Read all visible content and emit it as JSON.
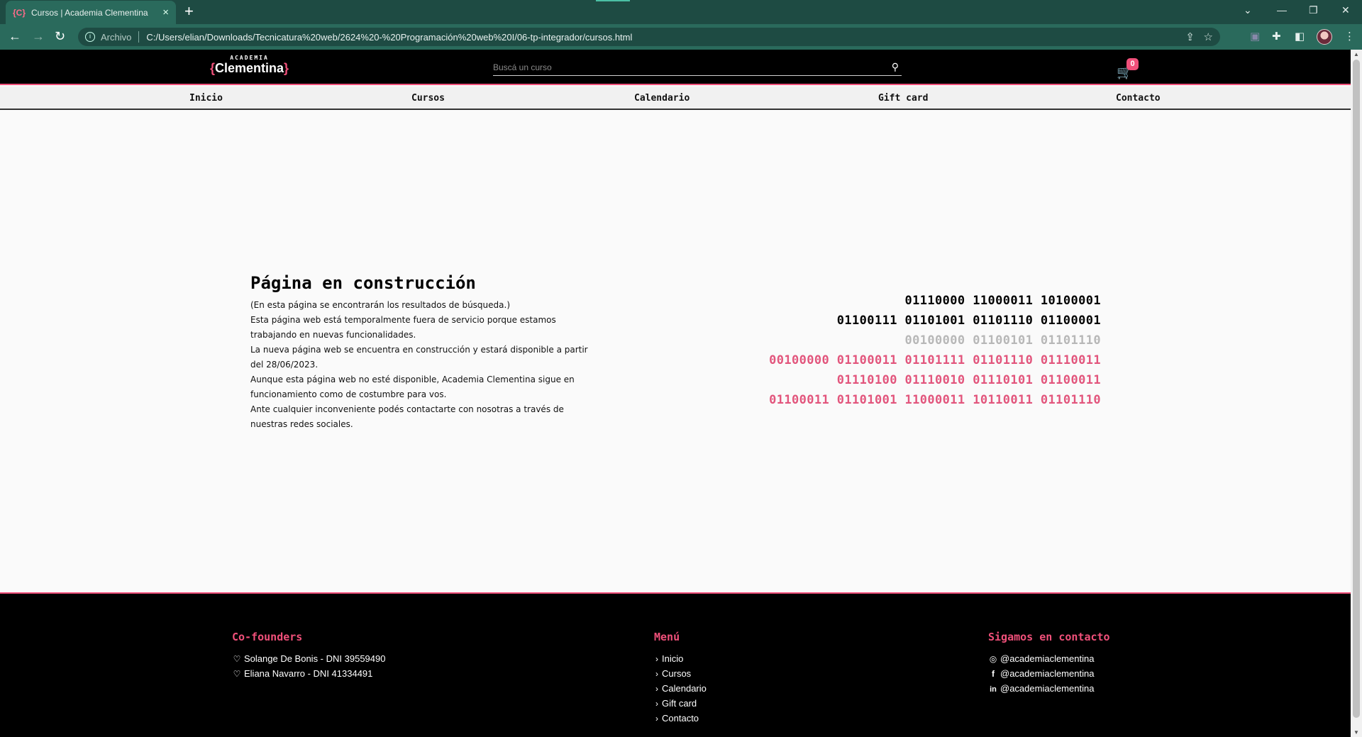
{
  "browser": {
    "tab_favicon": "{C}",
    "tab_title": "Cursos | Academia Clementina",
    "address_scheme": "Archivo",
    "address_url": "C:/Users/elian/Downloads/Tecnicatura%20web/2624%20-%20Programación%20web%20I/06-tp-integrador/cursos.html"
  },
  "header": {
    "logo_small": "ACADEMIA",
    "logo_left_brace": "{",
    "logo_name": "Clementina",
    "logo_right_brace": "}",
    "search_placeholder": "Buscá un curso",
    "cart_count": "0"
  },
  "nav": {
    "items": [
      {
        "label": "Inicio"
      },
      {
        "label": "Cursos"
      },
      {
        "label": "Calendario"
      },
      {
        "label": "Gift card"
      },
      {
        "label": "Contacto"
      }
    ]
  },
  "main": {
    "title": "Página en construcción",
    "paragraphs": [
      "(En esta página se encontrarán los resultados de búsqueda.)",
      "Esta página web está temporalmente fuera de servicio porque estamos trabajando en nuevas funcionalidades.",
      "La nueva página web se encuentra en construcción y estará disponible a partir del 28/06/2023.",
      "Aunque esta página web no esté disponible, Academia Clementina sigue en funcionamiento como de costumbre para vos.",
      "Ante cualquier inconveniente podés contactarte con nosotras a través de nuestras redes sociales."
    ],
    "binary_lines": [
      "01110000 11000011 10100001",
      "01100111 01101001 01101110 01100001",
      "00100000 01100101 01101110",
      "00100000 01100011 01101111 01101110 01110011",
      "01110100 01110010 01110101 01100011",
      "01100011 01101001 11000011 10110011 01101110"
    ]
  },
  "footer": {
    "cofounders_title": "Co-founders",
    "cofounders": [
      "Solange De Bonis - DNI 39559490",
      "Eliana Navarro - DNI 41334491"
    ],
    "menu_title": "Menú",
    "menu_items": [
      "Inicio",
      "Cursos",
      "Calendario",
      "Gift card",
      "Contacto"
    ],
    "social_title": "Sigamos en contacto",
    "social": [
      {
        "icon": "instagram-icon",
        "handle": "@academiaclementina"
      },
      {
        "icon": "facebook-icon",
        "handle": "@academiaclementina"
      },
      {
        "icon": "linkedin-icon",
        "handle": "@academiaclementina"
      }
    ]
  },
  "colors": {
    "accent_pink": "#f0507a",
    "chrome_green": "#2a6a5c"
  }
}
